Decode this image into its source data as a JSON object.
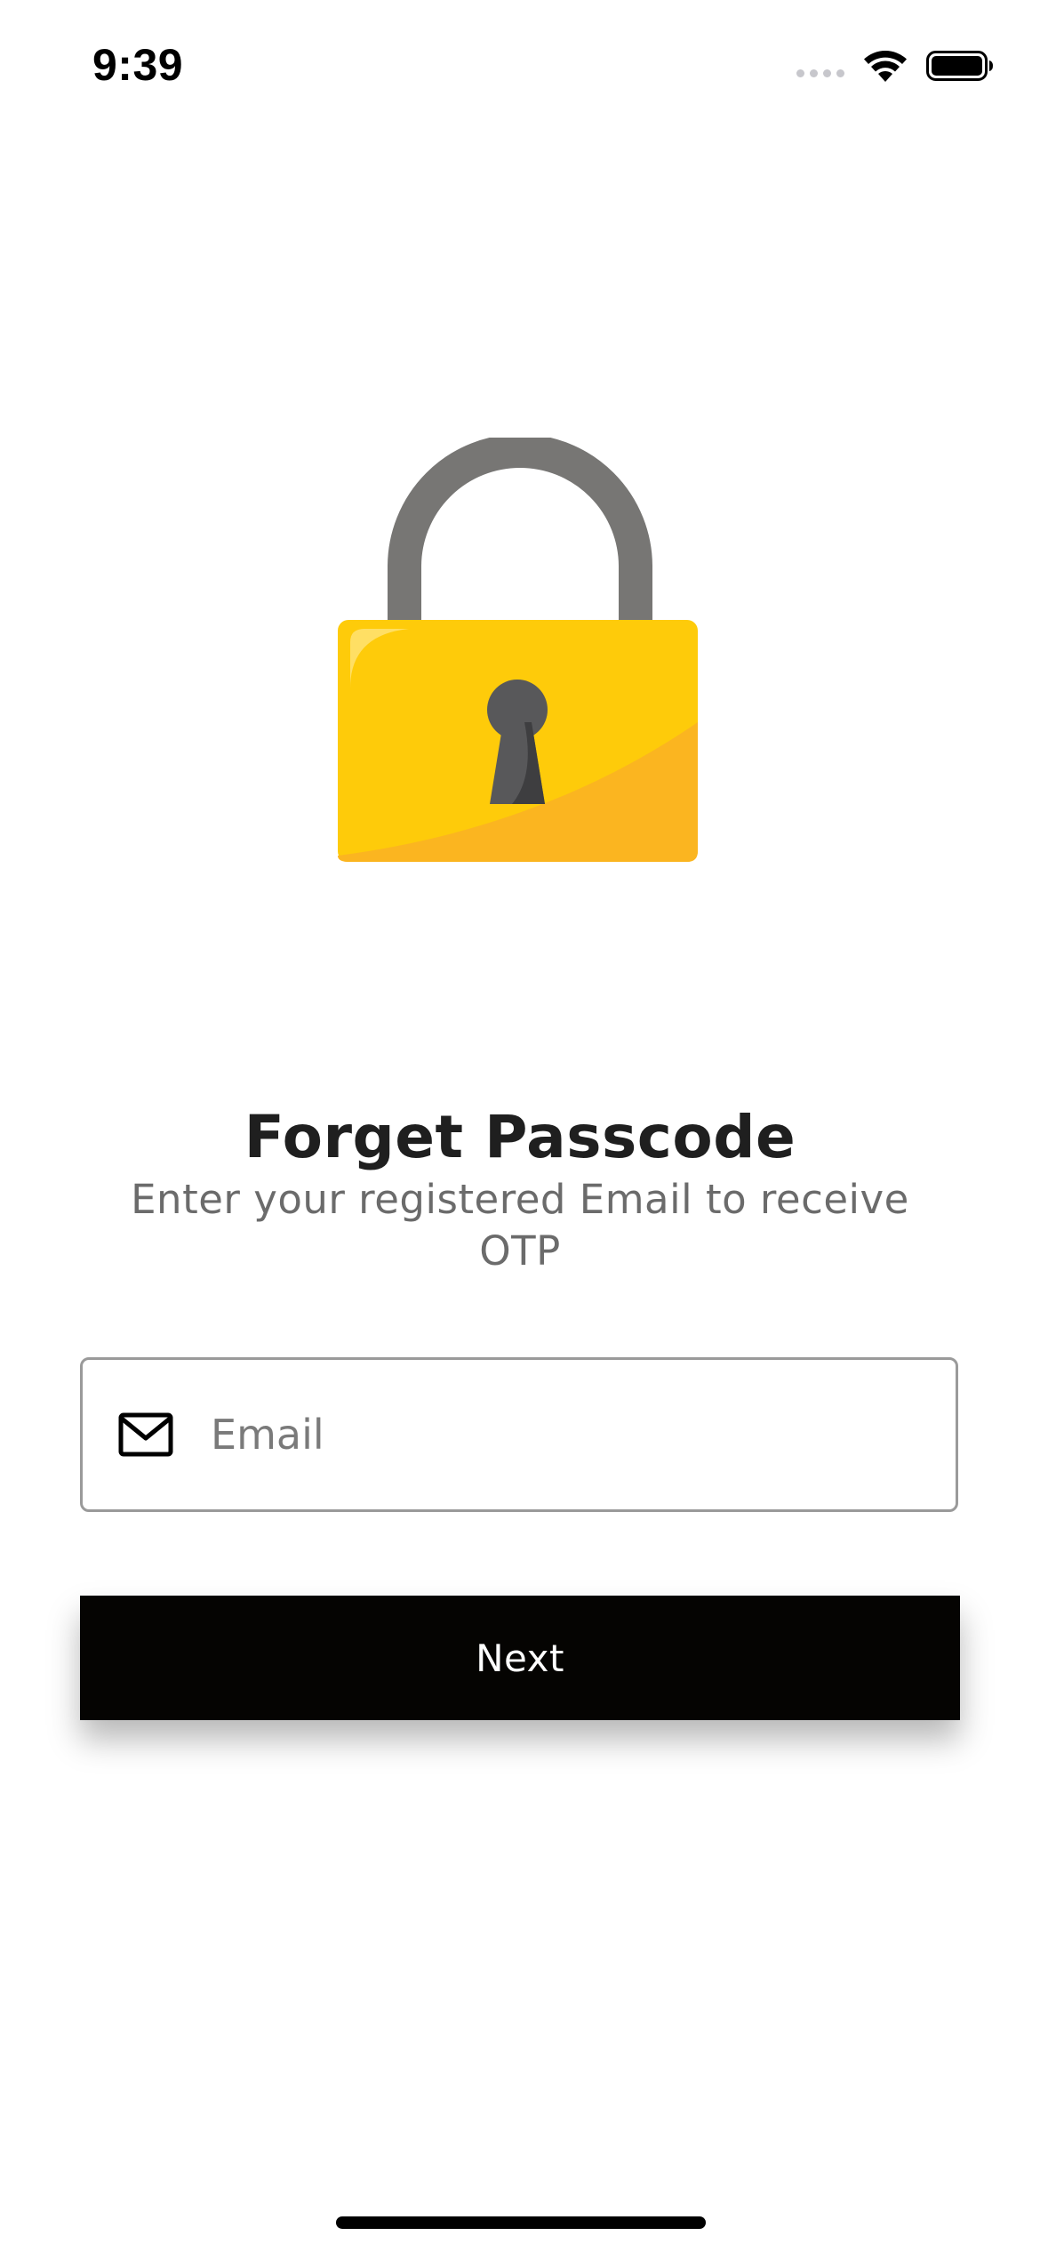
{
  "status_bar": {
    "time": "9:39",
    "icons": [
      "cellular-signal-icon",
      "wifi-icon",
      "battery-icon"
    ]
  },
  "illustration": {
    "icon": "padlock-icon",
    "colors": {
      "shackle": "#777674",
      "body": "#FECB0A",
      "body_shade": "#FBB520",
      "keyhole": "#58585A"
    }
  },
  "header": {
    "title": "Forget Passcode",
    "subtitle": "Enter your registered Email to receive OTP"
  },
  "form": {
    "email": {
      "icon": "mail-icon",
      "placeholder": "Email",
      "value": ""
    },
    "next_label": "Next"
  },
  "colors": {
    "background": "#FFFFFF",
    "button_background": "#050402",
    "button_text": "#FFFFFF",
    "field_border": "#9A9A9A",
    "subtitle_text": "#6B6B6B"
  }
}
